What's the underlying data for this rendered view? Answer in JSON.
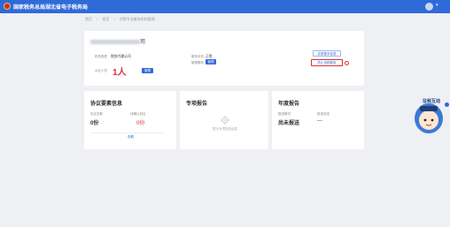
{
  "header": {
    "title": "国家税务总局湖北省电子税务局",
    "user_caret": "▾"
  },
  "breadcrumb": {
    "home": "首页",
    "sep1": "/",
    "item1": "首页",
    "sep2": "/",
    "current": "涉税专业服务机构管理"
  },
  "company": {
    "suffix": "司"
  },
  "main": {
    "org_type_label": "机构类型",
    "org_type_value": "税务代理公司",
    "practitioners_label": "从业人员",
    "practitioners_value": "1人",
    "manage_button": "管理",
    "service_status_label": "服务状态",
    "service_status_value": "正常",
    "manage_status_label": "管理模块",
    "manage_status_button": "管理",
    "button_top": "变更基本信息",
    "button_bottom": "终止涉税服务"
  },
  "agreement": {
    "title": "协议要素信息",
    "label1": "协议总数",
    "val1": "0份",
    "label2": "待确认协议",
    "val2": "0份",
    "link": "查看"
  },
  "special": {
    "title": "专项报告",
    "empty_text": "暂无专项报告信息"
  },
  "annual": {
    "title": "年度报告",
    "label1": "报送情况",
    "val1": "尚未报送",
    "label2": "报送状态",
    "val2": "—"
  },
  "mascot": {
    "text": "征税互动"
  },
  "colors": {
    "primary": "#2f6ad9",
    "danger": "#e02f2f"
  }
}
